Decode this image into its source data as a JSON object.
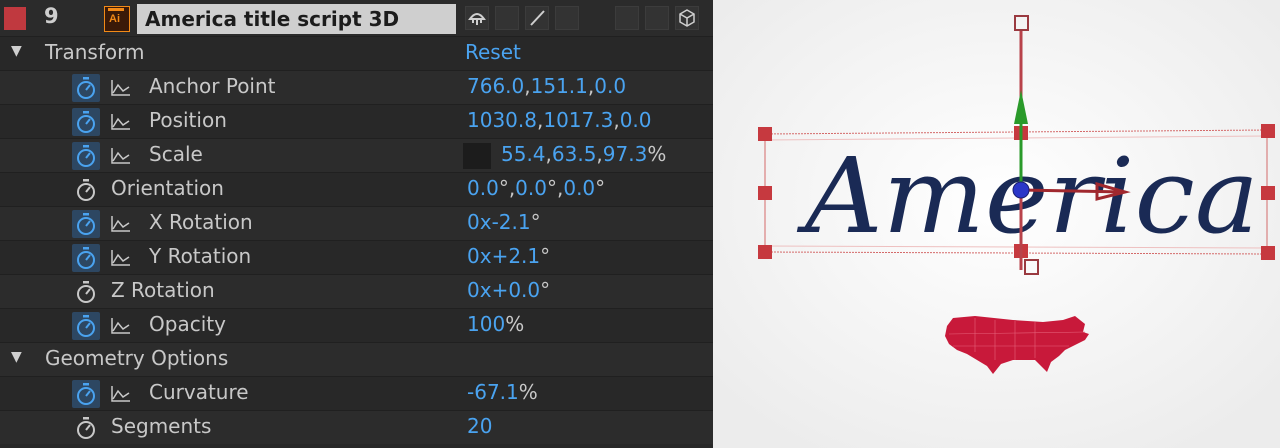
{
  "layer": {
    "number": "9",
    "name": "America title script 3D",
    "source_icon": "Ai",
    "label_color": "#c0393f"
  },
  "transform": {
    "group_label": "Transform",
    "reset_label": "Reset",
    "properties": [
      {
        "label": "Anchor Point",
        "v1": "766.0",
        "v2": "151.1",
        "v3": "0.0",
        "sep": ","
      },
      {
        "label": "Position",
        "v1": "1030.8",
        "v2": "1017.3",
        "v3": "0.0",
        "sep": ","
      },
      {
        "label": "Scale",
        "v1": "55.4",
        "v2": "63.5",
        "v3": "97.3",
        "sep": ",",
        "unit": "%"
      },
      {
        "label": "Orientation",
        "v1": "0.0",
        "v2": "0.0",
        "v3": "0.0",
        "deg": "°",
        "sep": ","
      },
      {
        "label": "X Rotation",
        "value": "0x",
        "value2": "-2.1",
        "deg": "°"
      },
      {
        "label": "Y Rotation",
        "value": "0x",
        "value2": "+2.1",
        "deg": "°"
      },
      {
        "label": "Z Rotation",
        "value": "0x",
        "value2": "+0.0",
        "deg": "°"
      },
      {
        "label": "Opacity",
        "value": "100",
        "unit": "%"
      }
    ]
  },
  "geometry": {
    "group_label": "Geometry Options",
    "properties": [
      {
        "label": "Curvature",
        "value": "-67.1",
        "unit": "%"
      },
      {
        "label": "Segments",
        "value": "20"
      }
    ]
  },
  "viewer": {
    "title_text": "America",
    "title_color": "#1a2a55",
    "map_color": "#c8193a"
  }
}
